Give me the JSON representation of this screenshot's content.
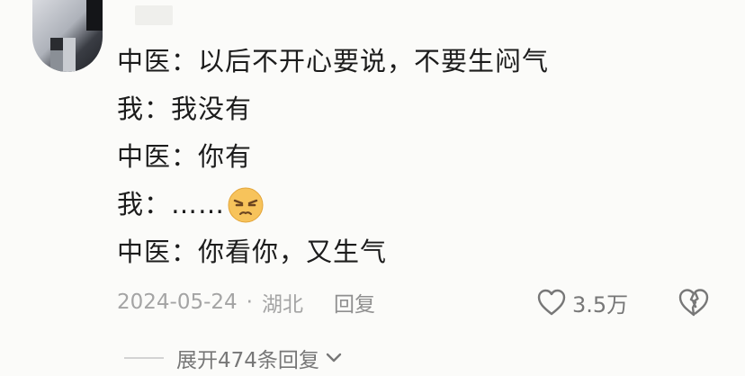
{
  "comment": {
    "lines": [
      "中医：以后不开心要说，不要生闷气",
      "我：我没有",
      "中医：你有",
      "我：……",
      "中医：你看你，又生气"
    ],
    "emoji_icon": "annoyed-face-emoji"
  },
  "meta": {
    "date": "2024-05-24",
    "separator": "·",
    "location": "湖北",
    "reply_label": "回复"
  },
  "actions": {
    "like_count": "3.5万",
    "like_icon": "heart-outline-icon",
    "dislike_icon": "broken-heart-icon"
  },
  "expand": {
    "label": "展开474条回复",
    "icon": "chevron-down-icon"
  }
}
